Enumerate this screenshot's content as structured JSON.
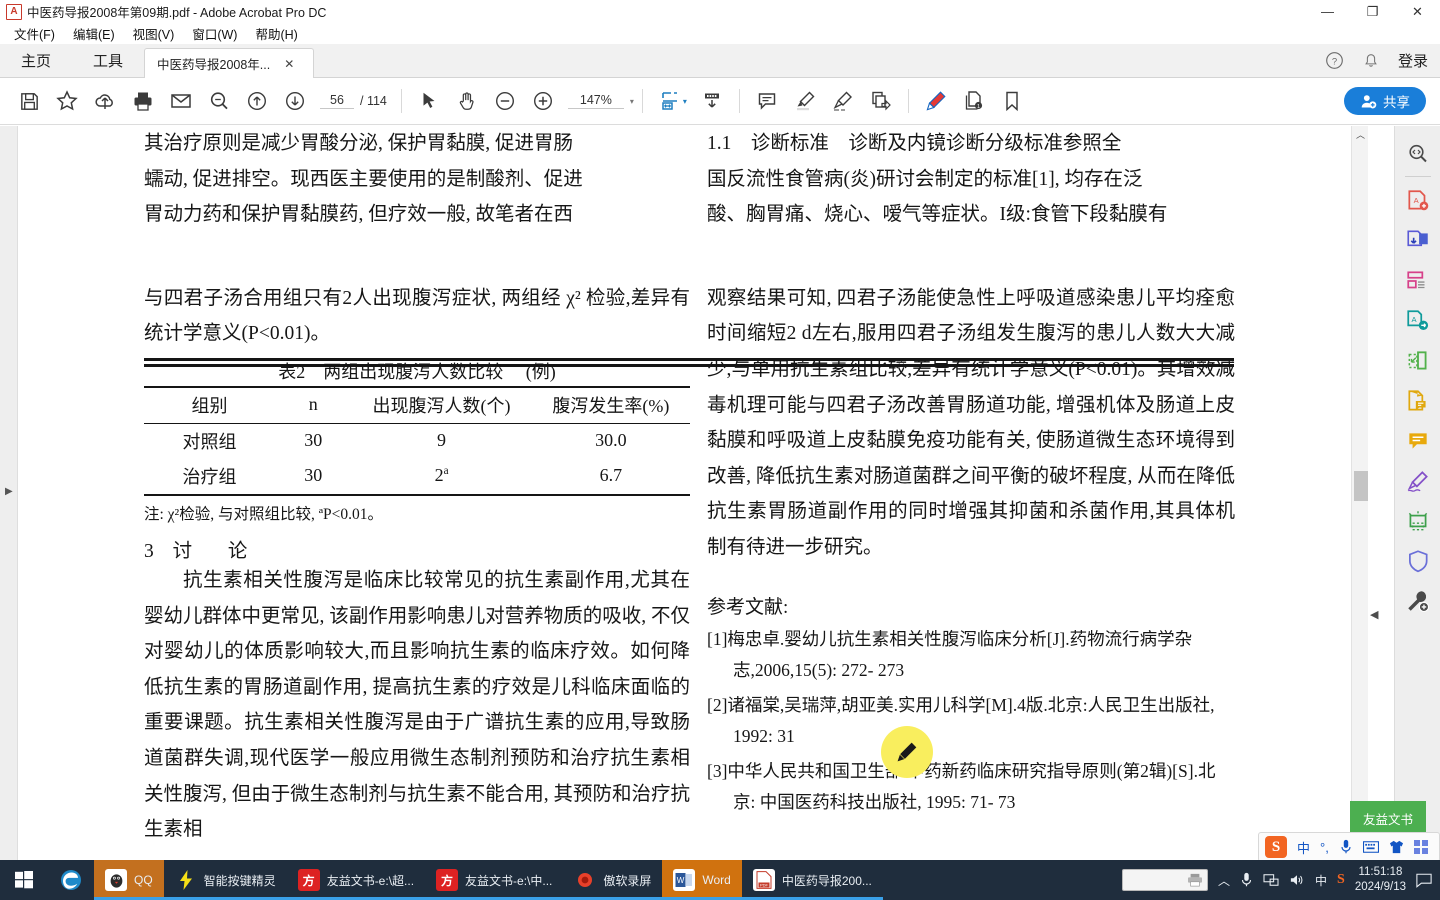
{
  "window": {
    "title": "中医药导报2008年第09期.pdf - Adobe Acrobat Pro DC",
    "app_icon": "pdf-file-icon",
    "minimize": "—",
    "restore": "❐",
    "close": "✕"
  },
  "menubar": [
    "文件(F)",
    "编辑(E)",
    "视图(V)",
    "窗口(W)",
    "帮助(H)"
  ],
  "tabstrip": {
    "home_label": "主页",
    "tools_label": "工具",
    "document_tab": "中医药导报2008年...",
    "tab_close": "✕",
    "help_icon": "question-circle-icon",
    "bell_icon": "bell-icon",
    "login_label": "登录"
  },
  "toolbar": {
    "icons": [
      "save-icon",
      "star-icon",
      "upload-cloud-icon",
      "print-icon",
      "email-icon",
      "zoom-search-icon",
      "previous-page-icon",
      "next-page-icon"
    ],
    "page_current": "56",
    "page_total": "/ 114",
    "select_tool": "cursor-arrow-icon",
    "hand_tool": "hand-icon",
    "zoom_out": "zoom-out-icon",
    "zoom_in": "zoom-in-icon",
    "zoom_value": "147%",
    "zoom_caret": "▾",
    "fit_page_icon": "fit-page-icon",
    "fit_caret": "▾",
    "scroll_mode_icon": "scroll-mode-icon",
    "comment_icon": "comment-icon",
    "highlight_icon": "highlight-pen-icon",
    "draw_icon": "draw-pen-icon",
    "stamp_icon": "stamp-icon",
    "pencil_icon": "red-pencil-icon",
    "pages_icon": "page-info-icon",
    "bookmark_icon": "bookmark-icon",
    "share_label": "共享",
    "share_icon": "add-person-icon",
    "share_color": "#1a7ed9"
  },
  "document": {
    "left_column": {
      "top_fragment": [
        "其治疗原则是减少胃酸分泌, 保护胃黏膜, 促进胃肠",
        "蠕动, 促进排空。现西医主要使用的是制酸剂、促进",
        "胃动力药和保护胃黏膜药, 但疗效一般, 故笔者在西"
      ],
      "para1": "与四君子汤合用组只有2人出现腹泻症状, 两组经 χ² 检验,差异有统计学意义(P<0.01)。",
      "table": {
        "caption_num": "表2",
        "caption_text": "两组出现腹泻人数比较",
        "caption_unit": "(例)",
        "headers": [
          "组别",
          "n",
          "出现腹泻人数(个)",
          "腹泻发生率(%)"
        ],
        "rows": [
          [
            "对照组",
            "30",
            "9",
            "30.0"
          ],
          [
            "治疗组",
            "30",
            "2",
            "6.7"
          ]
        ],
        "row2_superscript": "a",
        "note": "注: χ²检验, 与对照组比较, ªP<0.01。"
      },
      "section_number": "3",
      "section_title_a": "讨",
      "section_title_b": "论",
      "para2": "抗生素相关性腹泻是临床比较常见的抗生素副作用,尤其在婴幼儿群体中更常见, 该副作用影响患儿对营养物质的吸收, 不仅对婴幼儿的体质影响较大,而且影响抗生素的临床疗效。如何降低抗生素的胃肠道副作用, 提高抗生素的疗效是儿科临床面临的重要课题。抗生素相关性腹泻是由于广谱抗生素的应用,导致肠道菌群失调,现代医学一般应用微生态制剂预防和治疗抗生素相关性腹泻, 但由于微生态制剂与抗生素不能合用, 其预防和治疗抗生素相"
    },
    "right_column": {
      "top_fragment": [
        "1.1　诊断标准　诊断及内镜诊断分级标准参照全",
        "国反流性食管病(炎)研讨会制定的标准[1], 均存在泛",
        "酸、胸胃痛、烧心、嗳气等症状。I级:食管下段黏膜有"
      ],
      "para1": "观察结果可知, 四君子汤能使急性上呼吸道感染患儿平均痊愈时间缩短2 d左右,服用四君子汤组发生腹泻的患儿人数大大减少,与单用抗生素组比较,差异有统计学意义(P<0.01)。其增效减毒机理可能与四君子汤改善胃肠道功能, 增强机体及肠道上皮黏膜和呼吸道上皮黏膜免疫功能有关, 使肠道微生态环境得到改善, 降低抗生素对肠道菌群之间平衡的破坏程度, 从而在降低抗生素胃肠道副作用的同时增强其抑菌和杀菌作用,其具体机制有待进一步研究。",
      "references_title": "参考文献:",
      "references": [
        "[1]梅忠卓.婴幼儿抗生素相关性腹泻临床分析[J].药物流行病学杂志,2006,15(5): 272- 273",
        "[2]诸福棠,吴瑞萍,胡亚美.实用儿科学[M].4版.北京:人民卫生出版社, 1992: 31",
        "[3]中华人民共和国卫生部.中药新药临床研究指导原则(第2辑)[S].北京: 中国医药科技出版社, 1995: 71- 73"
      ]
    }
  },
  "right_rail": [
    "search-enhanced-icon",
    "create-pdf-icon",
    "export-pdf-icon",
    "organize-pages-icon",
    "send-pdf-icon",
    "crop-page-icon",
    "comment-file-icon",
    "comment-bubble-icon",
    "fill-sign-icon",
    "scan-ocr-icon",
    "protect-shield-icon",
    "tools-wrench-icon"
  ],
  "cursor": {
    "type": "pencil-cursor",
    "color": "#f9ee5e"
  },
  "ime_bar": {
    "logo": "S",
    "items": [
      "中",
      "°,",
      "mic-icon",
      "keyboard-icon",
      "skin-icon",
      "apps-icon"
    ]
  },
  "tooltip": {
    "text": "友益文书",
    "color": "#4caf50"
  },
  "taskbar": {
    "start": "windows-logo-icon",
    "quick": [
      "edge-browser-icon"
    ],
    "tasks": [
      {
        "label": "QQ",
        "icon": "qq-penguin-icon",
        "active": true
      },
      {
        "label": "智能按键精灵",
        "icon": "lightning-bolt-icon",
        "active": false
      },
      {
        "label": "友益文书-e:\\超...",
        "icon": "youyi-doc-icon",
        "active": false
      },
      {
        "label": "友益文书-e:\\中...",
        "icon": "youyi-doc-icon",
        "active": false
      },
      {
        "label": "傲软录屏",
        "icon": "record-circle-icon",
        "active": false
      },
      {
        "label": "Word",
        "icon": "word-icon",
        "active": true
      },
      {
        "label": "中医药导报200...",
        "icon": "pdf-file-icon",
        "active": false
      }
    ],
    "tray": {
      "chevron": "︿",
      "icons": [
        "mic-icon",
        "network-icon",
        "volume-icon"
      ],
      "ime_mode": "中",
      "sogou": "S",
      "time": "11:51:18",
      "date": "2024/9/13",
      "action_center": "notification-icon"
    }
  }
}
